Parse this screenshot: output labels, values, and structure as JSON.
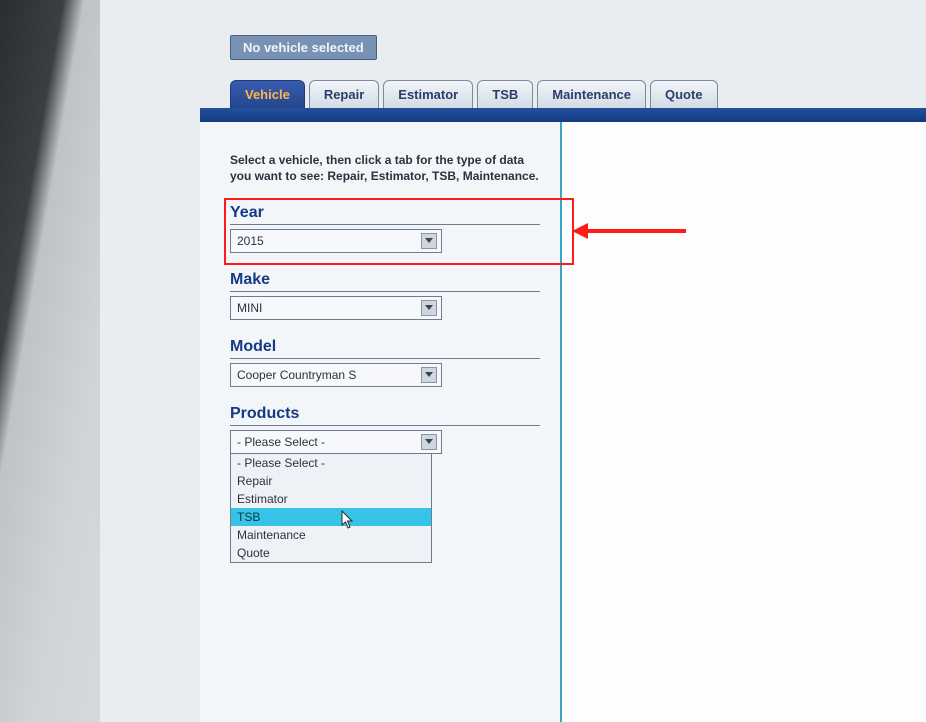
{
  "status_bar": {
    "text": "No vehicle selected"
  },
  "tabs": [
    {
      "label": "Vehicle",
      "active": true
    },
    {
      "label": "Repair"
    },
    {
      "label": "Estimator"
    },
    {
      "label": "TSB"
    },
    {
      "label": "Maintenance"
    },
    {
      "label": "Quote"
    }
  ],
  "instructions": "Select a vehicle, then click a tab for the type of data you want to see: Repair, Estimator, TSB, Maintenance.",
  "fields": {
    "year": {
      "label": "Year",
      "value": "2015"
    },
    "make": {
      "label": "Make",
      "value": "MINI"
    },
    "model": {
      "label": "Model",
      "value": "Cooper Countryman S"
    },
    "products": {
      "label": "Products",
      "value": "- Please Select -"
    }
  },
  "products_options": [
    "- Please Select -",
    "Repair",
    "Estimator",
    "TSB",
    "Maintenance",
    "Quote"
  ],
  "products_highlight_index": 3,
  "annotation": {
    "target": "year"
  },
  "colors": {
    "accent_blue": "#1d4796",
    "tab_active_text": "#ffb74a",
    "highlight_cyan": "#37c3e7",
    "annotation_red": "#ff1a1a"
  }
}
